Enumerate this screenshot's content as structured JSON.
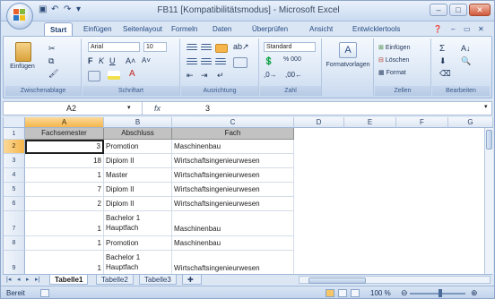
{
  "window": {
    "title": "FB11 [Kompatibilitätsmodus] - Microsoft Excel"
  },
  "ribbon_tabs": [
    "Start",
    "Einfügen",
    "Seitenlayout",
    "Formeln",
    "Daten",
    "Überprüfen",
    "Ansicht",
    "Entwicklertools"
  ],
  "ribbon": {
    "clipboard": {
      "paste_label": "Einfügen",
      "group_label": "Zwischenablage"
    },
    "font": {
      "font_name": "Arial",
      "font_size": "10",
      "group_label": "Schriftart"
    },
    "alignment": {
      "group_label": "Ausrichtung"
    },
    "number": {
      "format": "Standard",
      "percent": "% 000",
      "group_label": "Zahl"
    },
    "styles": {
      "label": "Formatvorlagen"
    },
    "cells": {
      "insert": "Einfügen",
      "delete": "Löschen",
      "format": "Format",
      "group_label": "Zellen"
    },
    "editing": {
      "group_label": "Bearbeiten"
    }
  },
  "formula_bar": {
    "name_box": "A2",
    "fx": "fx",
    "content": "3"
  },
  "columns": [
    "A",
    "B",
    "C",
    "D",
    "E",
    "F",
    "G"
  ],
  "rows": [
    "1",
    "2",
    "3",
    "4",
    "5",
    "6",
    "7",
    "8",
    "9"
  ],
  "table": {
    "headers": [
      "Fachsemester",
      "Abschluss",
      "Fach"
    ],
    "rows": [
      [
        "3",
        "Promotion",
        "Maschinenbau"
      ],
      [
        "18",
        "Diplom II",
        "Wirtschaftsingenieurwesen"
      ],
      [
        "1",
        "Master",
        "Wirtschaftsingenieurwesen"
      ],
      [
        "7",
        "Diplom II",
        "Wirtschaftsingenieurwesen"
      ],
      [
        "2",
        "Diplom II",
        "Wirtschaftsingenieurwesen"
      ],
      [
        "1",
        "Bachelor 1 Hauptfach",
        "Maschinenbau"
      ],
      [
        "1",
        "Promotion",
        "Maschinenbau"
      ],
      [
        "1",
        "Bachelor 1 Hauptfach",
        "Wirtschaftsingenieurwesen"
      ]
    ]
  },
  "sheet_tabs": [
    "Tabelle1",
    "Tabelle2",
    "Tabelle3"
  ],
  "status": {
    "ready": "Bereit",
    "zoom": "100 %"
  }
}
